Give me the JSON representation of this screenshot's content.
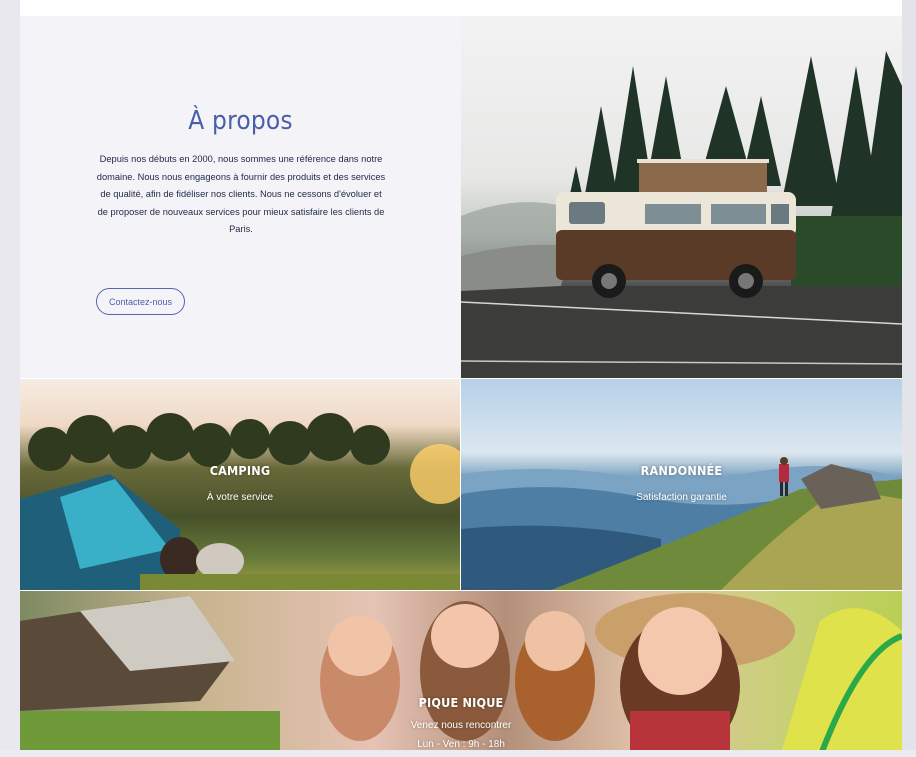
{
  "about": {
    "title": "À propos",
    "text": "Depuis nos débuts en 2000, nous sommes une référence dans notre domaine. Nous nous engageons à fournir des produits et des services de qualité, afin de fidéliser nos clients. Nous ne cessons d'évoluer et de proposer de nouveaux services pour mieux satisfaire les clients de Paris.",
    "contact_button": "Contactez-nous"
  },
  "tiles": [
    {
      "title": "CAMPING",
      "subtitle": "À votre service"
    },
    {
      "title": "RANDONNÉE",
      "subtitle": "Satisfaction garantie"
    },
    {
      "title": "PIQUE NIQUE",
      "subtitle": "Venez nous rencontrer",
      "subtitle2": "Lun - Ven : 9h - 18h"
    }
  ],
  "colors": {
    "accent": "#4a5fa8",
    "about_bg": "#f4f4f8",
    "text_dark": "#222a4a"
  }
}
